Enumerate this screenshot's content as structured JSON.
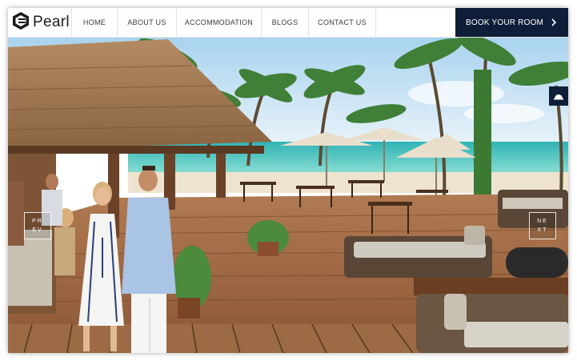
{
  "brand": {
    "name": "Pearl",
    "logo_icon": "hexagon-logo-icon"
  },
  "nav": {
    "items": [
      {
        "label": "HOME"
      },
      {
        "label": "ABOUT US"
      },
      {
        "label": "ACCOMMODATION"
      },
      {
        "label": "BLOGS"
      },
      {
        "label": "CONTACT US"
      }
    ],
    "cta_label": "BOOK YOUR ROOM",
    "cta_icon": "chevron-right-icon"
  },
  "slider": {
    "prev_top": "PR",
    "prev_bottom": "EV",
    "next_top": "NE",
    "next_bottom": "XT",
    "side_icon": "half-moon-icon"
  },
  "colors": {
    "nav_bg": "#ffffff",
    "accent": "#0f1e38",
    "deck": "#a8724a",
    "sea": "#5fc9c2",
    "sky": "#cfe7f6"
  }
}
